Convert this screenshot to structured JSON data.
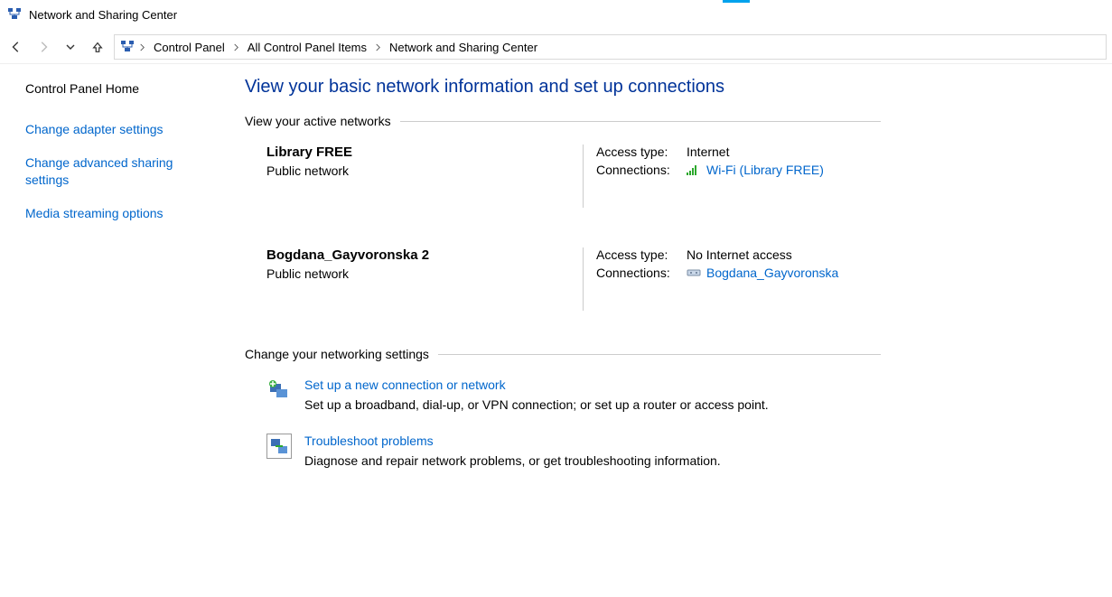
{
  "window": {
    "title": "Network and Sharing Center"
  },
  "breadcrumb": {
    "items": [
      "Control Panel",
      "All Control Panel Items",
      "Network and Sharing Center"
    ]
  },
  "sidebar": {
    "home": "Control Panel Home",
    "links": [
      "Change adapter settings",
      "Change advanced sharing settings",
      "Media streaming options"
    ]
  },
  "page": {
    "title": "View your basic network information and set up connections",
    "active_networks_header": "View your active networks",
    "change_settings_header": "Change your networking settings"
  },
  "networks": [
    {
      "name": "Library FREE",
      "category": "Public network",
      "access_type_label": "Access type:",
      "access_type_value": "Internet",
      "connections_label": "Connections:",
      "connection_name": "Wi-Fi (Library FREE)",
      "icon": "wifi"
    },
    {
      "name": "Bogdana_Gayvoronska 2",
      "category": "Public network",
      "access_type_label": "Access type:",
      "access_type_value": "No Internet access",
      "connections_label": "Connections:",
      "connection_name": "Bogdana_Gayvoronska",
      "icon": "ethernet"
    }
  ],
  "settings": [
    {
      "title": "Set up a new connection or network",
      "desc": "Set up a broadband, dial-up, or VPN connection; or set up a router or access point."
    },
    {
      "title": "Troubleshoot problems",
      "desc": "Diagnose and repair network problems, or get troubleshooting information."
    }
  ]
}
